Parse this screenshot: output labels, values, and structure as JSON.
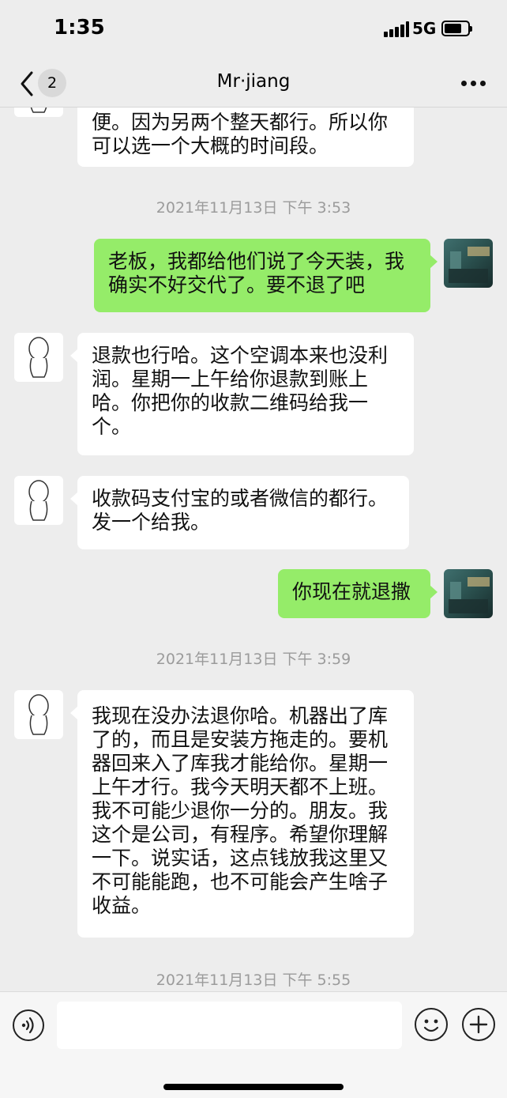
{
  "status_bar": {
    "time": "1:35",
    "network": "5G",
    "battery_level": 0.75,
    "signal_icon": "signal-bars-icon",
    "battery_icon": "battery-icon"
  },
  "nav": {
    "back_icon": "chevron-left-icon",
    "unread_count": "2",
    "title": "Mr·jiang",
    "more_icon": "more-dots-icon"
  },
  "messages": [
    {
      "side": "in",
      "text": "便。因为另两个整天都行。所以你\n可以选一个大概的时间段。"
    },
    {
      "timestamp": "2021年11月13日 下午 3:53"
    },
    {
      "side": "out",
      "text": "老板，我都给他们说了今天装，我\n确实不好交代了。要不退了吧"
    },
    {
      "side": "in",
      "text": "退款也行哈。这个空调本来也没利\n润。星期一上午给你退款到账上\n哈。你把你的收款二维码给我一\n个。"
    },
    {
      "side": "in",
      "text": "收款码支付宝的或者微信的都行。\n发一个给我。"
    },
    {
      "side": "out",
      "text": "你现在就退撒"
    },
    {
      "timestamp": "2021年11月13日 下午 3:59"
    },
    {
      "side": "in",
      "text": "我现在没办法退你哈。机器出了库\n了的，而且是安装方拖走的。要机\n器回来入了库我才能给你。星期一\n上午才行。我今天明天都不上班。\n我不可能少退你一分的。朋友。我\n这个是公司，有程序。希望你理解\n一下。说实话，这点钱放我这里又\n不可能能跑，也不可能会产生啥子\n收益。"
    },
    {
      "timestamp": "2021年11月13日 下午 5:55"
    }
  ],
  "input_bar": {
    "voice_icon": "voice-icon",
    "message_placeholder": "",
    "emoji_icon": "emoji-icon",
    "plus_icon": "plus-icon"
  },
  "colors": {
    "background": "#ededed",
    "incoming_bubble": "#ffffff",
    "outgoing_bubble": "#95ec69",
    "timestamp_text": "#9b9b9b"
  }
}
